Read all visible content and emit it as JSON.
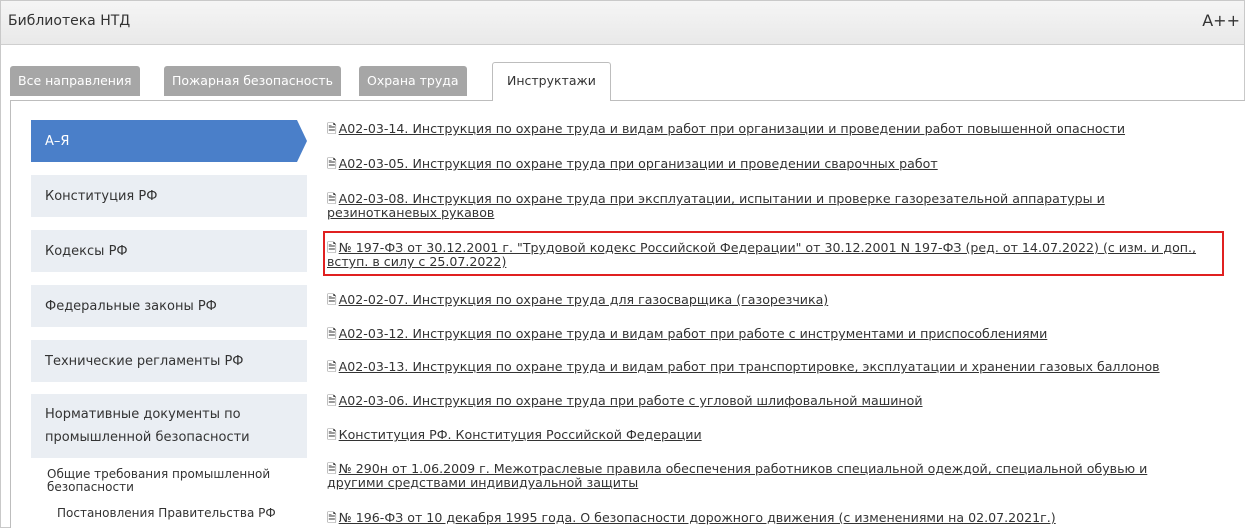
{
  "window": {
    "title": "Библиотека НТД",
    "font_size_control": "A++"
  },
  "tabs": [
    {
      "label": "Все направления"
    },
    {
      "label": "Пожарная безопасность"
    },
    {
      "label": "Охрана труда"
    },
    {
      "label": "Инструктажи",
      "active": true
    }
  ],
  "sidebar": {
    "items": [
      {
        "label": "А–Я",
        "active": true
      },
      {
        "label": "Конституция РФ"
      },
      {
        "label": "Кодексы РФ"
      },
      {
        "label": "Федеральные законы РФ"
      },
      {
        "label": "Технические регламенты РФ"
      },
      {
        "label": "Нормативные документы по\nпромышленной безопасности"
      }
    ],
    "subitems": [
      {
        "label": "Общие требования промышленной\nбезопасности"
      },
      {
        "label": "Постановления Правительства РФ"
      }
    ]
  },
  "documents": [
    {
      "icon": "document-icon",
      "text": "А02-03-14. Инструкция по охране труда и видам работ при организации и проведении работ повышенной опасности"
    },
    {
      "icon": "document-icon",
      "text": "А02-03-05. Инструкция по охране труда при организации и проведении сварочных работ"
    },
    {
      "icon": "document-icon",
      "text": "А02-03-08. Инструкция по охране труда при эксплуатации, испытании и проверке газорезательной аппаратуры и\nрезинотканевых рукавов"
    },
    {
      "icon": "document-icon",
      "text": "№ 197-ФЗ от 30.12.2001 г. \"Трудовой кодекс Российской Федерации\" от 30.12.2001 N 197-ФЗ (ред. от 14.07.2022) (с изм. и доп.,\nвступ. в силу с 25.07.2022)",
      "highlighted": true
    },
    {
      "icon": "document-icon",
      "text": "А02-02-07. Инструкция по охране труда для газосварщика (газорезчика)"
    },
    {
      "icon": "document-icon",
      "text": "А02-03-12. Инструкция по охране труда и видам работ при работе с инструментами и приспособлениями"
    },
    {
      "icon": "document-icon",
      "text": "А02-03-13. Инструкция по охране труда и видам работ при транспортировке, эксплуатации и хранении газовых баллонов"
    },
    {
      "icon": "document-icon",
      "text": "А02-03-06. Инструкция по охране труда при работе с угловой шлифовальной машиной"
    },
    {
      "icon": "document-icon",
      "text": "Конституция РФ. Конституция Российской Федерации"
    },
    {
      "icon": "document-icon",
      "text": "№ 290н от 1.06.2009 г. Межотраслевые правила обеспечения работников специальной одеждой, специальной обувью и\nдругими средствами индивидуальной защиты"
    },
    {
      "icon": "document-icon",
      "text": "№ 196-ФЗ от 10 декабря 1995 года. О безопасности дорожного движения (с изменениями на 02.07.2021г.)"
    }
  ],
  "colors": {
    "accent": "#4a7fc9",
    "highlight_border": "#e02020",
    "tab_inactive": "#a6a6a6",
    "sidebar_bg": "#eaeef3"
  }
}
